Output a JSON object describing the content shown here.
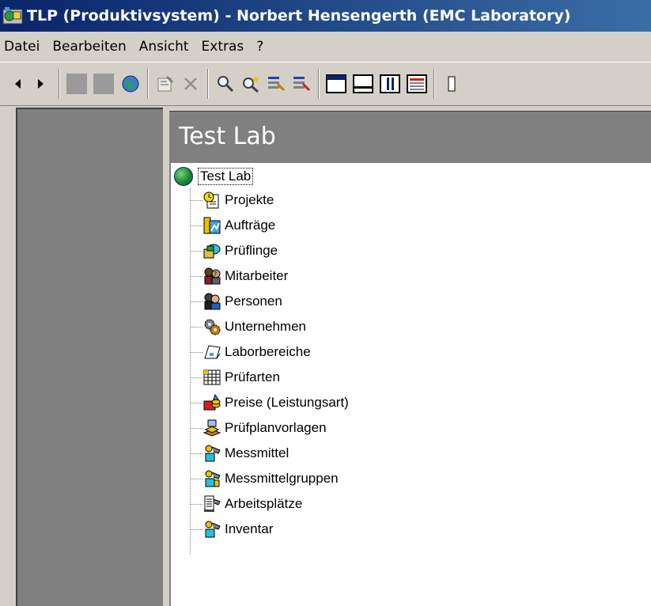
{
  "window": {
    "title": "TLP (Produktivsystem) - Norbert Hensengerth (EMC Laboratory)"
  },
  "menu": [
    "Datei",
    "Bearbeiten",
    "Ansicht",
    "Extras",
    "?"
  ],
  "toolbar": {
    "buttons": [
      {
        "name": "back-arrow-icon"
      },
      {
        "name": "forward-arrow-icon"
      },
      {
        "name": "blank-button-icon"
      },
      {
        "name": "blank-button-icon"
      },
      {
        "name": "globe-icon"
      },
      {
        "name": "properties-icon"
      },
      {
        "name": "delete-icon"
      },
      {
        "name": "search-icon"
      },
      {
        "name": "search-new-icon"
      },
      {
        "name": "list-edit-icon"
      },
      {
        "name": "list-remove-icon"
      },
      {
        "name": "window-top-icon"
      },
      {
        "name": "window-bottom-icon"
      },
      {
        "name": "columns-icon"
      },
      {
        "name": "details-icon"
      }
    ]
  },
  "header": {
    "title": "Test Lab"
  },
  "tree": {
    "root": {
      "label": "Test Lab",
      "icon": "globe-icon"
    },
    "items": [
      {
        "label": "Projekte",
        "icon": "clock-document-icon"
      },
      {
        "label": "Aufträge",
        "icon": "order-chart-icon"
      },
      {
        "label": "Prüflinge",
        "icon": "device-box-icon"
      },
      {
        "label": "Mitarbeiter",
        "icon": "employee-icon"
      },
      {
        "label": "Personen",
        "icon": "persons-icon"
      },
      {
        "label": "Unternehmen",
        "icon": "company-gears-icon"
      },
      {
        "label": "Laborbereiche",
        "icon": "lab-area-icon"
      },
      {
        "label": "Prüfarten",
        "icon": "grid-table-icon"
      },
      {
        "label": "Preise (Leistungsart)",
        "icon": "price-icon"
      },
      {
        "label": "Prüfplanvorlagen",
        "icon": "test-plan-icon"
      },
      {
        "label": "Messmittel",
        "icon": "measuring-device-icon"
      },
      {
        "label": "Messmittelgruppen",
        "icon": "measuring-group-icon"
      },
      {
        "label": "Arbeitsplätze",
        "icon": "workstation-icon"
      },
      {
        "label": "Inventar",
        "icon": "inventory-icon"
      }
    ]
  },
  "colors": {
    "title_bar_start": "#0a246a",
    "title_bar_end": "#3a6ea5",
    "window_face": "#d4d0c8",
    "panel_dark": "#808080"
  }
}
